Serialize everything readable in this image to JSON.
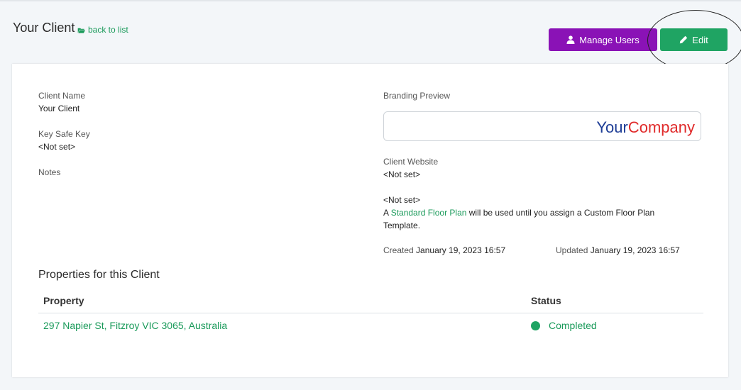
{
  "header": {
    "title": "Your Client",
    "back_label": "back to list",
    "manage_users_label": "Manage Users",
    "edit_label": "Edit"
  },
  "details": {
    "client_name_label": "Client Name",
    "client_name_value": "Your Client",
    "key_safe_label": "Key Safe Key",
    "key_safe_value": "<Not set>",
    "notes_label": "Notes",
    "branding_label": "Branding Preview",
    "brand_logo_part1": "Your",
    "brand_logo_part2": "Company",
    "website_label": "Client Website",
    "website_value": "<Not set>",
    "floor_plan_value": "<Not set>",
    "floor_plan_prefix": "A ",
    "floor_plan_link": "Standard Floor Plan",
    "floor_plan_suffix": " will be used until you assign a Custom Floor Plan Template.",
    "created_label": "Created",
    "created_value": "January 19, 2023 16:57",
    "updated_label": "Updated",
    "updated_value": "January 19, 2023 16:57"
  },
  "properties": {
    "section_title": "Properties for this Client",
    "columns": [
      "Property",
      "Status"
    ],
    "rows": [
      {
        "property": "297 Napier St, Fitzroy VIC 3065, Australia",
        "status": "Completed"
      }
    ]
  },
  "colors": {
    "accent_green": "#1fa463",
    "manage_purple": "#8a12b6",
    "brand_blue": "#1e3d96",
    "brand_red": "#e02a2a"
  },
  "icons": {
    "back": "folder-open-icon",
    "manage_users": "user-icon",
    "edit": "pencil-icon",
    "status": "status-dot-icon"
  }
}
